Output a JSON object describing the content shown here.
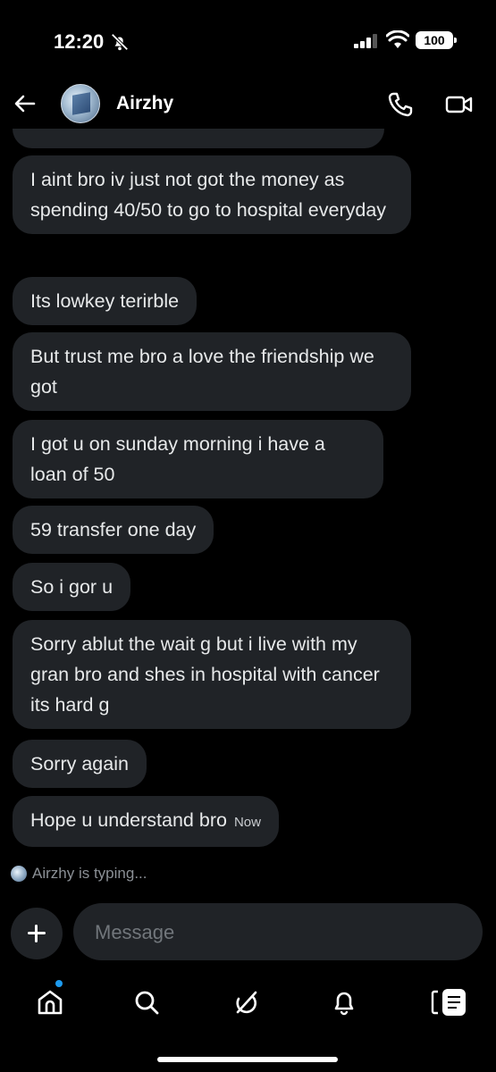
{
  "status_bar": {
    "time": "12:20",
    "battery": "100"
  },
  "header": {
    "contact_name": "Airzhy"
  },
  "messages": [
    {
      "text": "I aint bro iv just not got the money as spending 40/50 to go to hospital everyday",
      "timestamp": ""
    },
    {
      "text": "Its lowkey terirble",
      "timestamp": ""
    },
    {
      "text": "But trust me bro a love the friendship we got",
      "timestamp": ""
    },
    {
      "text": "I got u on sunday morning i have a loan of 50",
      "timestamp": ""
    },
    {
      "text": "59 transfer one day",
      "timestamp": ""
    },
    {
      "text": "So i gor u",
      "timestamp": ""
    },
    {
      "text": "Sorry ablut the wait g but i live with my gran bro and shes in hospital with cancer its hard g",
      "timestamp": ""
    },
    {
      "text": "Sorry again",
      "timestamp": ""
    },
    {
      "text": "Hope u understand bro",
      "timestamp": "Now"
    }
  ],
  "typing_indicator": "Airzhy is typing...",
  "composer": {
    "placeholder": "Message"
  },
  "nav": {
    "items": [
      {
        "icon": "home-icon",
        "has_notification_dot": true
      },
      {
        "icon": "search-icon"
      },
      {
        "icon": "grok-icon"
      },
      {
        "icon": "bell-icon"
      },
      {
        "icon": "messages-icon"
      }
    ]
  },
  "colors": {
    "background": "#000000",
    "bubble": "#202327",
    "accent": "#1d9bf0",
    "text": "#e7e9ea"
  }
}
